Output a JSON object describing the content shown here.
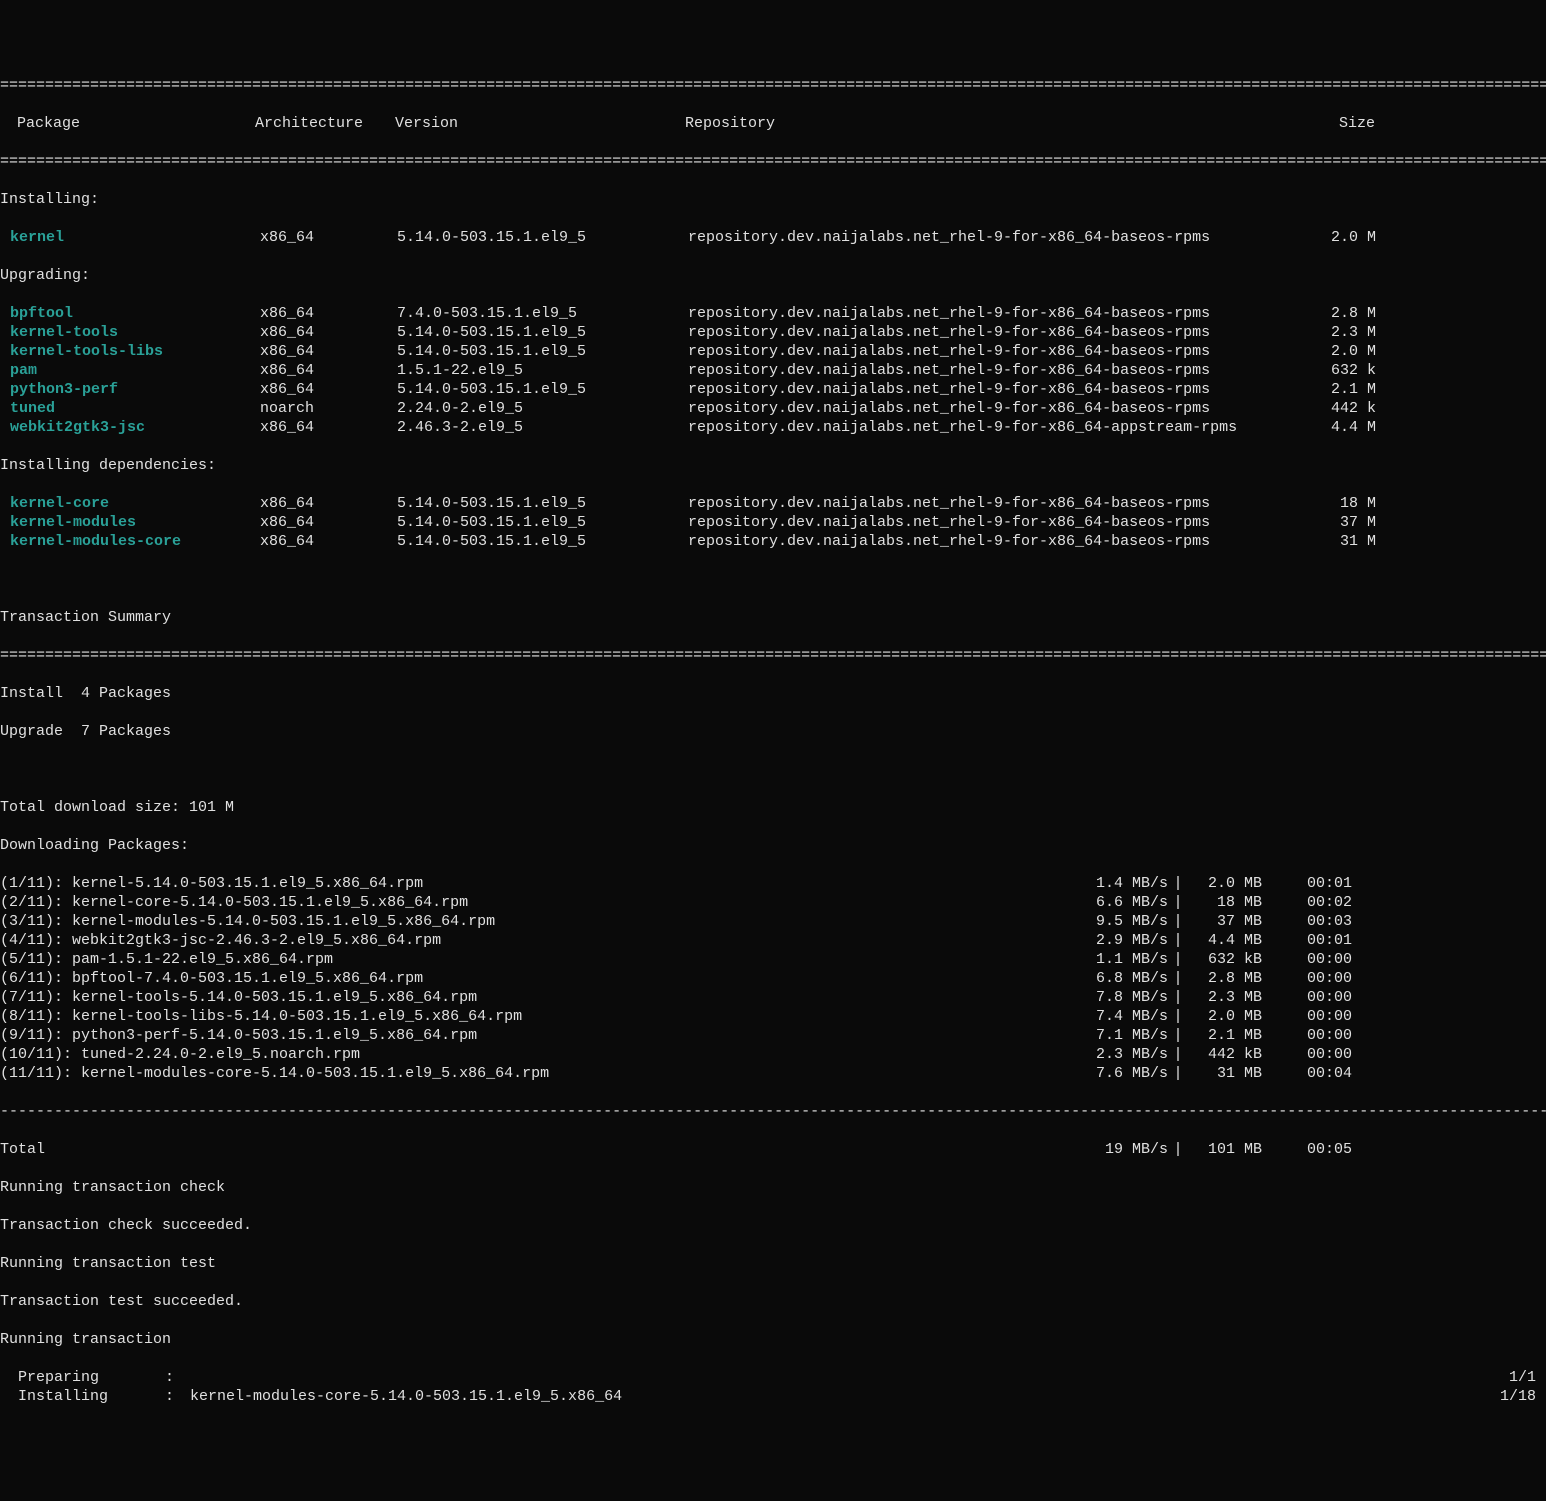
{
  "divider_thick": "================================================================================================================================================================================",
  "divider_thin": "--------------------------------------------------------------------------------------------------------------------------------------------------------------------------------",
  "headers": {
    "package": " Package",
    "arch": "Architecture",
    "version": "Version",
    "repo": "Repository",
    "size": "Size"
  },
  "sections": {
    "installing": "Installing:",
    "upgrading": "Upgrading:",
    "installing_deps": "Installing dependencies:"
  },
  "installing": [
    {
      "name": "kernel",
      "arch": "x86_64",
      "version": "5.14.0-503.15.1.el9_5",
      "repo": "repository.dev.naijalabs.net_rhel-9-for-x86_64-baseos-rpms",
      "size": "2.0 M"
    }
  ],
  "upgrading": [
    {
      "name": "bpftool",
      "arch": "x86_64",
      "version": "7.4.0-503.15.1.el9_5",
      "repo": "repository.dev.naijalabs.net_rhel-9-for-x86_64-baseos-rpms",
      "size": "2.8 M"
    },
    {
      "name": "kernel-tools",
      "arch": "x86_64",
      "version": "5.14.0-503.15.1.el9_5",
      "repo": "repository.dev.naijalabs.net_rhel-9-for-x86_64-baseos-rpms",
      "size": "2.3 M"
    },
    {
      "name": "kernel-tools-libs",
      "arch": "x86_64",
      "version": "5.14.0-503.15.1.el9_5",
      "repo": "repository.dev.naijalabs.net_rhel-9-for-x86_64-baseos-rpms",
      "size": "2.0 M"
    },
    {
      "name": "pam",
      "arch": "x86_64",
      "version": "1.5.1-22.el9_5",
      "repo": "repository.dev.naijalabs.net_rhel-9-for-x86_64-baseos-rpms",
      "size": "632 k"
    },
    {
      "name": "python3-perf",
      "arch": "x86_64",
      "version": "5.14.0-503.15.1.el9_5",
      "repo": "repository.dev.naijalabs.net_rhel-9-for-x86_64-baseos-rpms",
      "size": "2.1 M"
    },
    {
      "name": "tuned",
      "arch": "noarch",
      "version": "2.24.0-2.el9_5",
      "repo": "repository.dev.naijalabs.net_rhel-9-for-x86_64-baseos-rpms",
      "size": "442 k"
    },
    {
      "name": "webkit2gtk3-jsc",
      "arch": "x86_64",
      "version": "2.46.3-2.el9_5",
      "repo": "repository.dev.naijalabs.net_rhel-9-for-x86_64-appstream-rpms",
      "size": "4.4 M"
    }
  ],
  "installing_deps": [
    {
      "name": "kernel-core",
      "arch": "x86_64",
      "version": "5.14.0-503.15.1.el9_5",
      "repo": "repository.dev.naijalabs.net_rhel-9-for-x86_64-baseos-rpms",
      "size": "18 M"
    },
    {
      "name": "kernel-modules",
      "arch": "x86_64",
      "version": "5.14.0-503.15.1.el9_5",
      "repo": "repository.dev.naijalabs.net_rhel-9-for-x86_64-baseos-rpms",
      "size": "37 M"
    },
    {
      "name": "kernel-modules-core",
      "arch": "x86_64",
      "version": "5.14.0-503.15.1.el9_5",
      "repo": "repository.dev.naijalabs.net_rhel-9-for-x86_64-baseos-rpms",
      "size": "31 M"
    }
  ],
  "summary": {
    "title": "Transaction Summary",
    "install": "Install  4 Packages",
    "upgrade": "Upgrade  7 Packages",
    "blank": "",
    "total_download": "Total download size: 101 M",
    "downloading": "Downloading Packages:"
  },
  "downloads": [
    {
      "label": "(1/11): kernel-5.14.0-503.15.1.el9_5.x86_64.rpm",
      "speed": "1.4 MB/s",
      "size": "2.0 MB",
      "time": "00:01"
    },
    {
      "label": "(2/11): kernel-core-5.14.0-503.15.1.el9_5.x86_64.rpm",
      "speed": "6.6 MB/s",
      "size": " 18 MB",
      "time": "00:02"
    },
    {
      "label": "(3/11): kernel-modules-5.14.0-503.15.1.el9_5.x86_64.rpm",
      "speed": "9.5 MB/s",
      "size": " 37 MB",
      "time": "00:03"
    },
    {
      "label": "(4/11): webkit2gtk3-jsc-2.46.3-2.el9_5.x86_64.rpm",
      "speed": "2.9 MB/s",
      "size": "4.4 MB",
      "time": "00:01"
    },
    {
      "label": "(5/11): pam-1.5.1-22.el9_5.x86_64.rpm",
      "speed": "1.1 MB/s",
      "size": "632 kB",
      "time": "00:00"
    },
    {
      "label": "(6/11): bpftool-7.4.0-503.15.1.el9_5.x86_64.rpm",
      "speed": "6.8 MB/s",
      "size": "2.8 MB",
      "time": "00:00"
    },
    {
      "label": "(7/11): kernel-tools-5.14.0-503.15.1.el9_5.x86_64.rpm",
      "speed": "7.8 MB/s",
      "size": "2.3 MB",
      "time": "00:00"
    },
    {
      "label": "(8/11): kernel-tools-libs-5.14.0-503.15.1.el9_5.x86_64.rpm",
      "speed": "7.4 MB/s",
      "size": "2.0 MB",
      "time": "00:00"
    },
    {
      "label": "(9/11): python3-perf-5.14.0-503.15.1.el9_5.x86_64.rpm",
      "speed": "7.1 MB/s",
      "size": "2.1 MB",
      "time": "00:00"
    },
    {
      "label": "(10/11): tuned-2.24.0-2.el9_5.noarch.rpm",
      "speed": "2.3 MB/s",
      "size": "442 kB",
      "time": "00:00"
    },
    {
      "label": "(11/11): kernel-modules-core-5.14.0-503.15.1.el9_5.x86_64.rpm",
      "speed": "7.6 MB/s",
      "size": " 31 MB",
      "time": "00:04"
    }
  ],
  "total": {
    "label": "Total",
    "speed": " 19 MB/s",
    "size": "101 MB",
    "time": "00:05"
  },
  "post": {
    "check": "Running transaction check",
    "check_ok": "Transaction check succeeded.",
    "test": "Running transaction test",
    "test_ok": "Transaction test succeeded.",
    "running": "Running transaction"
  },
  "transaction": [
    {
      "label": "Preparing",
      "pkg": "",
      "count": "1/1"
    },
    {
      "label": "Installing",
      "pkg": "kernel-modules-core-5.14.0-503.15.1.el9_5.x86_64",
      "count": "1/18"
    }
  ]
}
